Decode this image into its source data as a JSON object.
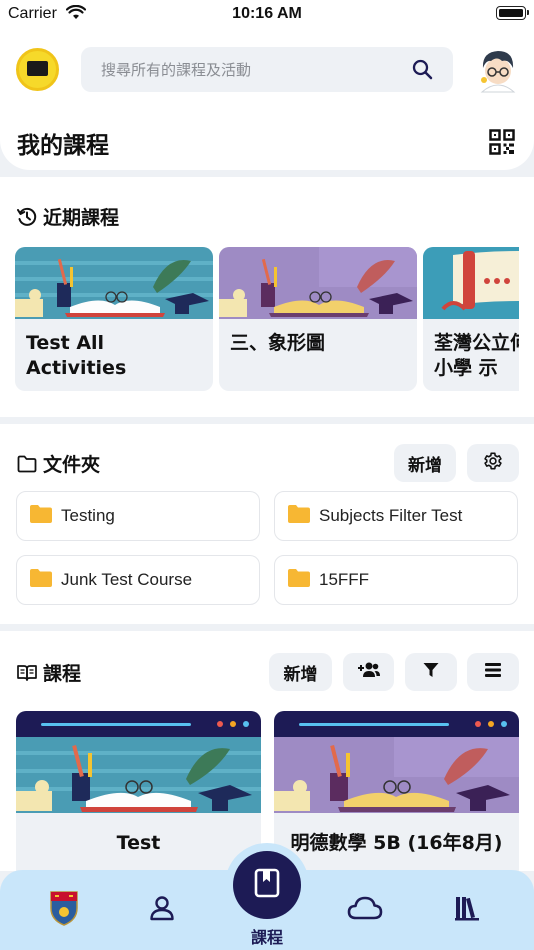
{
  "status_bar": {
    "carrier": "Carrier",
    "time": "10:16 AM"
  },
  "header": {
    "search_placeholder": "搜尋所有的課程及活動",
    "title": "我的課程"
  },
  "recent": {
    "title": "近期課程",
    "items": [
      {
        "name": "Test All Activities"
      },
      {
        "name": "三、象形圖"
      },
      {
        "name": "荃灣公立何傳耀紀念小學 示"
      }
    ]
  },
  "folders": {
    "title": "文件夾",
    "add_label": "新增",
    "items": [
      {
        "name": "Testing"
      },
      {
        "name": "Subjects Filter Test"
      },
      {
        "name": "Junk Test Course"
      },
      {
        "name": "15FFF"
      }
    ]
  },
  "courses": {
    "title": "課程",
    "add_label": "新增",
    "items": [
      {
        "name": "Test"
      },
      {
        "name": "明德數學 5B (16年8月)"
      }
    ]
  },
  "tabbar": {
    "active_label": "課程"
  },
  "colors": {
    "navy": "#1d1b55",
    "tab_bg": "#c9e6fa",
    "folder_yellow": "#f7b733",
    "accent_blue": "#58c1f0"
  }
}
